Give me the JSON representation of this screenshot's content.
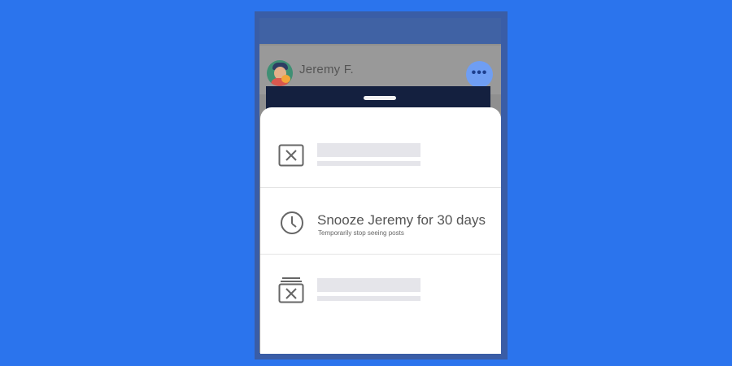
{
  "post": {
    "author": "Jeremy F.",
    "more_label": "•••"
  },
  "menu": {
    "items": [
      {
        "icon": "x-square-icon",
        "label": "",
        "sublabel": ""
      },
      {
        "icon": "clock-icon",
        "label": "Snooze Jeremy for 30 days",
        "sublabel": "Temporarily stop seeing posts"
      },
      {
        "icon": "stacked-x-square-icon",
        "label": "",
        "sublabel": ""
      }
    ]
  },
  "colors": {
    "background": "#2b74ed",
    "phone_frame": "#3a5da6",
    "dim_overlay": "#999999",
    "more_button": "#6f9ef3",
    "sheet": "#ffffff"
  }
}
